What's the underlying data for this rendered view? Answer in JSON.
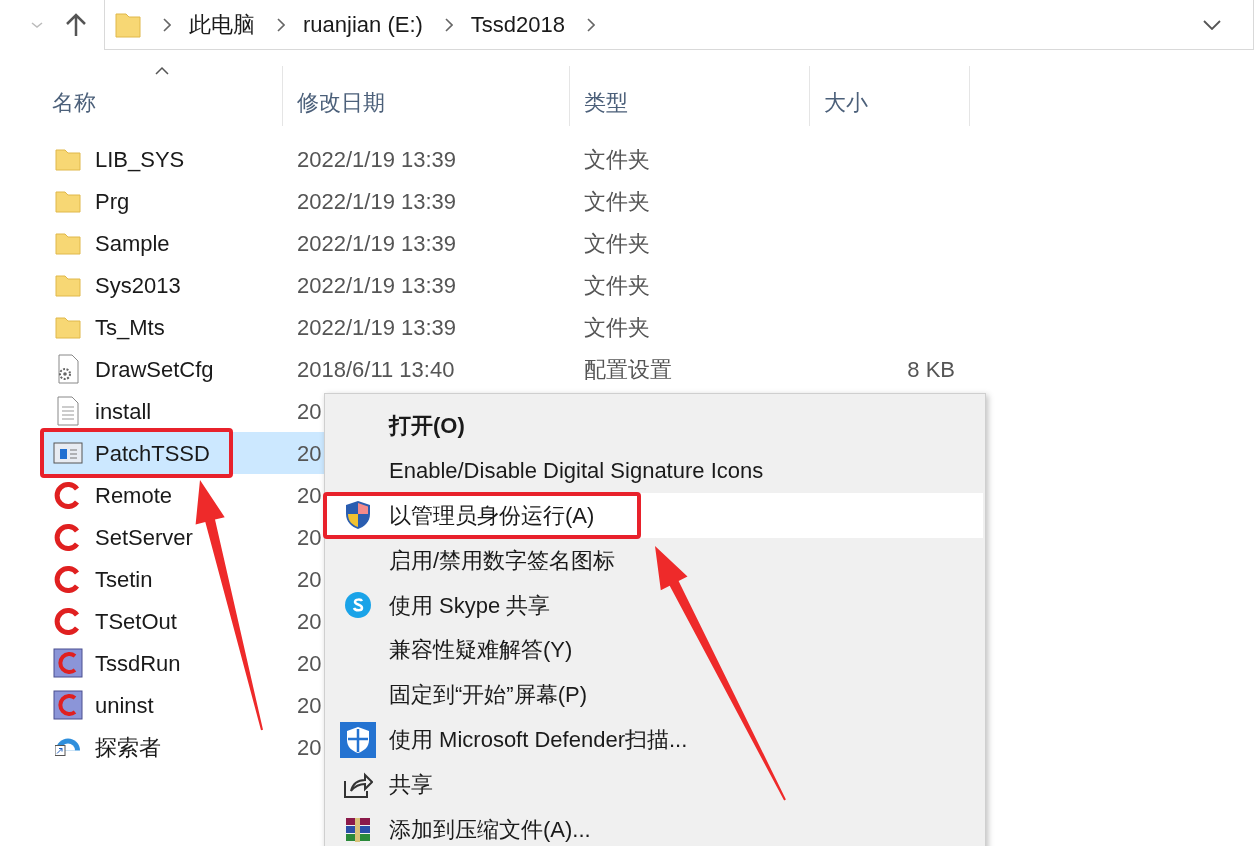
{
  "address": {
    "crumbs": [
      "此电脑",
      "ruanjian (E:)",
      "Tssd2018"
    ]
  },
  "columns": [
    {
      "label": "名称",
      "sorted": true
    },
    {
      "label": "修改日期",
      "sorted": false
    },
    {
      "label": "类型",
      "sorted": false
    },
    {
      "label": "大小",
      "sorted": false
    }
  ],
  "files": [
    {
      "name": "LIB_SYS",
      "kind": "folder",
      "date": "2022/1/19 13:39",
      "type": "文件夹",
      "selected": false,
      "marked": false
    },
    {
      "name": "Prg",
      "kind": "folder",
      "date": "2022/1/19 13:39",
      "type": "文件夹",
      "selected": false,
      "marked": false
    },
    {
      "name": "Sample",
      "kind": "folder",
      "date": "2022/1/19 13:39",
      "type": "文件夹",
      "selected": false,
      "marked": false
    },
    {
      "name": "Sys2013",
      "kind": "folder",
      "date": "2022/1/19 13:39",
      "type": "文件夹",
      "selected": false,
      "marked": false
    },
    {
      "name": "Ts_Mts",
      "kind": "folder",
      "date": "2022/1/19 13:39",
      "type": "文件夹",
      "selected": false,
      "marked": false
    },
    {
      "name": "DrawSetCfg",
      "kind": "config",
      "date": "2018/6/11 13:40",
      "type": "配置设置",
      "size": "8 KB",
      "selected": false,
      "marked": false
    },
    {
      "name": "install",
      "kind": "text",
      "date": "20",
      "selected": false,
      "marked": false
    },
    {
      "name": "PatchTSSD",
      "kind": "app",
      "date": "20",
      "selected": true,
      "marked": true
    },
    {
      "name": "Remote",
      "kind": "logo",
      "date": "20",
      "selected": false,
      "marked": false
    },
    {
      "name": "SetServer",
      "kind": "logo",
      "date": "20",
      "selected": false,
      "marked": false
    },
    {
      "name": "Tsetin",
      "kind": "logo",
      "date": "20",
      "selected": false,
      "marked": false
    },
    {
      "name": "TSetOut",
      "kind": "logo",
      "date": "20",
      "selected": false,
      "marked": false
    },
    {
      "name": "TssdRun",
      "kind": "tile",
      "date": "20",
      "selected": false,
      "marked": false
    },
    {
      "name": "uninst",
      "kind": "tile",
      "date": "20",
      "selected": false,
      "marked": false
    },
    {
      "name": "探索者",
      "kind": "cloud",
      "date": "20",
      "selected": false,
      "marked": false
    }
  ],
  "context_menu": {
    "items": [
      {
        "label": "打开(O)",
        "kind": "plain",
        "default": true,
        "selected": false,
        "marked": false
      },
      {
        "label": "Enable/Disable Digital Signature Icons",
        "kind": "plain",
        "default": false,
        "selected": false,
        "marked": false
      },
      {
        "label": "以管理员身份运行(A)",
        "kind": "shield",
        "default": false,
        "selected": true,
        "marked": true
      },
      {
        "label": "启用/禁用数字签名图标",
        "kind": "plain",
        "default": false,
        "selected": false,
        "marked": false
      },
      {
        "label": "使用 Skype 共享",
        "kind": "skype",
        "default": false,
        "selected": false,
        "marked": false
      },
      {
        "label": "兼容性疑难解答(Y)",
        "kind": "plain",
        "default": false,
        "selected": false,
        "marked": false
      },
      {
        "label": "固定到“开始”屏幕(P)",
        "kind": "plain",
        "default": false,
        "selected": false,
        "marked": false
      },
      {
        "label": "使用 Microsoft Defender扫描...",
        "kind": "defender",
        "default": false,
        "selected": false,
        "marked": false
      },
      {
        "label": "共享",
        "kind": "share",
        "default": false,
        "selected": false,
        "marked": false
      },
      {
        "label": "添加到压缩文件(A)...",
        "kind": "archive",
        "default": false,
        "selected": false,
        "marked": false
      }
    ]
  }
}
